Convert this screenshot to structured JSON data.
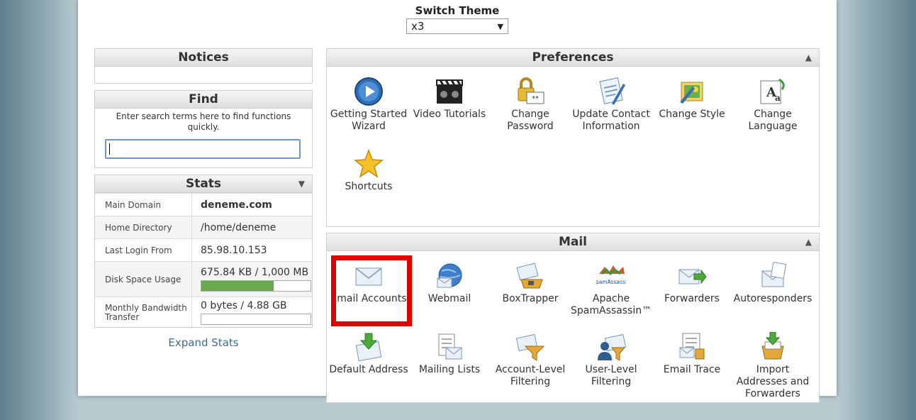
{
  "theme": {
    "label": "Switch Theme",
    "value": "x3"
  },
  "notices": {
    "title": "Notices"
  },
  "find": {
    "title": "Find",
    "hint": "Enter search terms here to find functions quickly.",
    "value": ""
  },
  "stats": {
    "title": "Stats",
    "rows": [
      {
        "label": "Main Domain",
        "value": "deneme.com"
      },
      {
        "label": "Home Directory",
        "value": "/home/deneme"
      },
      {
        "label": "Last Login From",
        "value": "85.98.10.153"
      },
      {
        "label": "Disk Space Usage",
        "value": "675.84 KB / 1,000 MB",
        "fill": 0.66
      },
      {
        "label": "Monthly Bandwidth Transfer",
        "value": "0 bytes / 4.88 GB",
        "fill": 0.0
      }
    ],
    "expand_label": "Expand Stats"
  },
  "preferences": {
    "title": "Preferences",
    "items": [
      {
        "label": "Getting Started Wizard",
        "icon": "getting-started-icon"
      },
      {
        "label": "Video Tutorials",
        "icon": "video-tutorials-icon"
      },
      {
        "label": "Change Password",
        "icon": "change-password-icon"
      },
      {
        "label": "Update Contact Information",
        "icon": "contact-info-icon"
      },
      {
        "label": "Change Style",
        "icon": "change-style-icon"
      },
      {
        "label": "Change Language",
        "icon": "change-language-icon"
      },
      {
        "label": "Shortcuts",
        "icon": "shortcuts-icon"
      }
    ]
  },
  "mail": {
    "title": "Mail",
    "items": [
      {
        "label": "Email Accounts",
        "icon": "email-accounts-icon"
      },
      {
        "label": "Webmail",
        "icon": "webmail-icon"
      },
      {
        "label": "BoxTrapper",
        "icon": "boxtrapper-icon"
      },
      {
        "label": "Apache SpamAssassin™",
        "icon": "spamassassin-icon",
        "logo_text": "SpamAssassin"
      },
      {
        "label": "Forwarders",
        "icon": "forwarders-icon"
      },
      {
        "label": "Autoresponders",
        "icon": "autoresponders-icon"
      },
      {
        "label": "Default Address",
        "icon": "default-address-icon"
      },
      {
        "label": "Mailing Lists",
        "icon": "mailing-lists-icon"
      },
      {
        "label": "Account-Level Filtering",
        "icon": "account-filtering-icon"
      },
      {
        "label": "User-Level Filtering",
        "icon": "user-filtering-icon"
      },
      {
        "label": "Email Trace",
        "icon": "email-trace-icon"
      },
      {
        "label": "Import Addresses and Forwarders",
        "icon": "import-addresses-icon"
      }
    ]
  },
  "colors": {
    "highlight": "#e00000",
    "link": "#3a6e8f",
    "accent_blue": "#2f6db5"
  }
}
